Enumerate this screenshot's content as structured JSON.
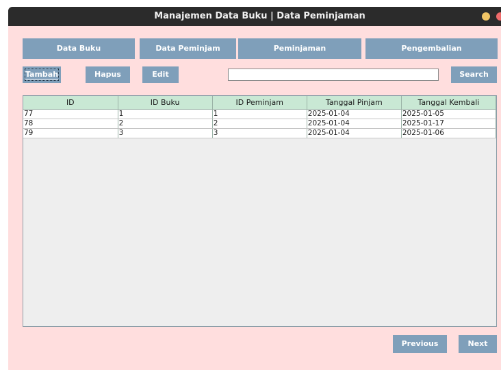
{
  "window": {
    "title": "Manajemen Data Buku | Data Peminjaman"
  },
  "nav": [
    {
      "label": "Data Buku"
    },
    {
      "label": "Data Peminjam"
    },
    {
      "label": "Peminjaman"
    },
    {
      "label": "Pengembalian"
    }
  ],
  "actions": {
    "tambah": "Tambah",
    "hapus": "Hapus",
    "edit": "Edit",
    "search": "Search"
  },
  "search": {
    "value": ""
  },
  "table": {
    "headers": [
      "ID",
      "ID Buku",
      "ID Peminjam",
      "Tanggal Pinjam",
      "Tanggal Kembali"
    ],
    "rows": [
      [
        "77",
        "1",
        "1",
        "2025-01-04",
        "2025-01-05"
      ],
      [
        "78",
        "2",
        "2",
        "2025-01-04",
        "2025-01-17"
      ],
      [
        "79",
        "3",
        "3",
        "2025-01-04",
        "2025-01-06"
      ]
    ]
  },
  "pagination": {
    "previous": "Previous",
    "next": "Next"
  },
  "colors": {
    "background": "#ffdede",
    "button": "#7f9fba",
    "header": "#c9e8d4",
    "titlebar": "#2b2b2b"
  }
}
